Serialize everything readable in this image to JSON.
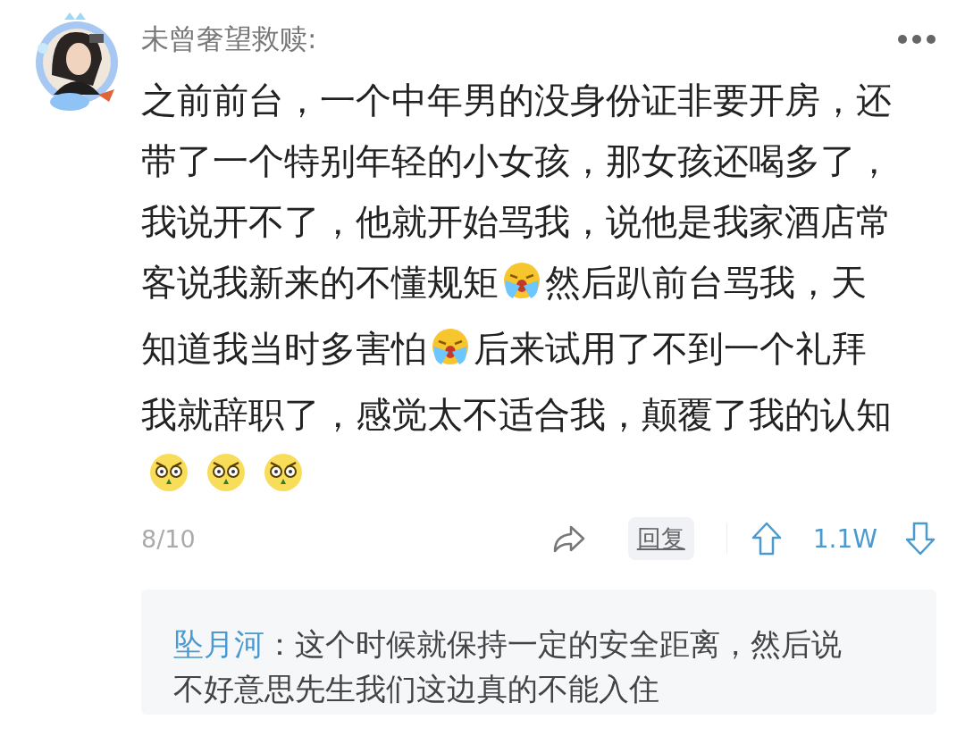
{
  "comment": {
    "author": "未曾奢望救赎:",
    "body_lines": [
      [
        {
          "kind": "text",
          "text": "之前前台，一个中年男的没身份证非要开房，还"
        }
      ],
      [
        {
          "kind": "text",
          "text": "带了一个特别年轻的小女孩，那女孩还喝多了，"
        }
      ],
      [
        {
          "kind": "text",
          "text": "我说开不了，他就开始骂我，说他是我家酒店常"
        }
      ],
      [
        {
          "kind": "text",
          "text": "客说我新来的不懂规矩"
        },
        {
          "kind": "crying_emoji"
        },
        {
          "kind": "text",
          "text": "然后趴前台骂我，天"
        }
      ],
      [
        {
          "kind": "text",
          "text": "知道我当时多害怕"
        },
        {
          "kind": "crying_emoji"
        },
        {
          "kind": "text",
          "text": "后来试用了不到一个礼拜"
        }
      ],
      [
        {
          "kind": "text",
          "text": "我就辞职了，感觉太不适合我，颠覆了我的认知"
        }
      ]
    ],
    "emoji_row": [
      {
        "kind": "angry_emoji"
      },
      {
        "kind": "angry_emoji"
      },
      {
        "kind": "angry_emoji"
      }
    ],
    "position": "8/10",
    "reply_button": "回复",
    "votes": "1.1W",
    "replies": [
      {
        "author": "坠月河",
        "text": "：这个时候就保持一定的安全距离，然后说不好意思先生我们这边真的不能入住"
      }
    ]
  }
}
